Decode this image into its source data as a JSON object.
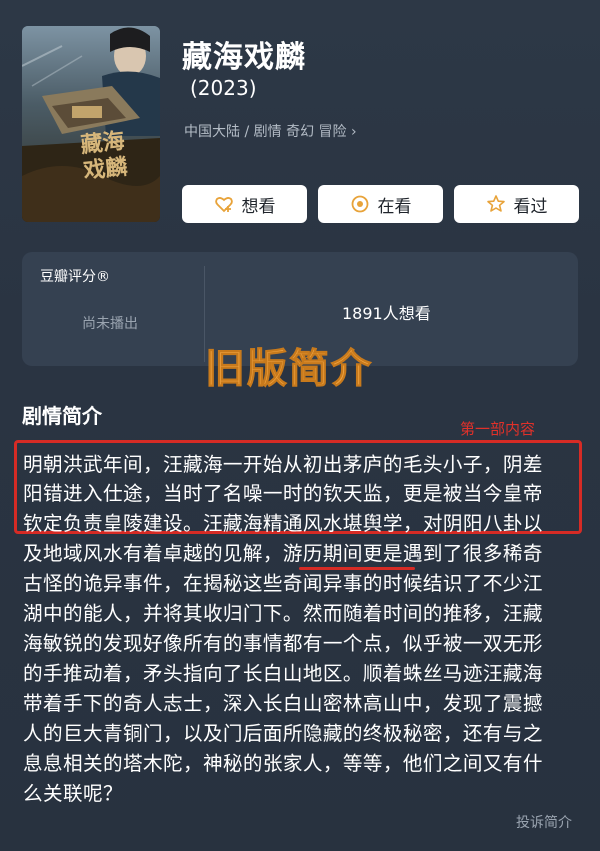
{
  "movie": {
    "title": "藏海戏麟",
    "year": "(2023)",
    "meta": "中国大陆 / 剧情 奇幻 冒险 ›",
    "poster_text": "藏海戏麟"
  },
  "actions": {
    "want": "想看",
    "watching": "在看",
    "watched": "看过"
  },
  "rating": {
    "label": "豆瓣评分®",
    "status": "尚未播出",
    "wish_count": "1891人想看"
  },
  "annotation": {
    "old_version": "旧版简介",
    "part_one": "第一部内容"
  },
  "synopsis": {
    "title": "剧情简介",
    "lines": [
      "明朝洪武年间，汪藏海一开始从初出茅庐的毛头小子，阴差",
      "阳错进入仕途，当时了名噪一时的钦天监，更是被当今皇帝",
      "钦定负责皇陵建设。汪藏海精通风水堪舆学，对阴阳八卦以",
      "及地域风水有着卓越的见解，游历期间更是遇到了很多稀奇",
      "古怪的诡异事件，在揭秘这些奇闻异事的时候结识了不少江",
      "湖中的能人，并将其收归门下。然而随着时间的推移，汪藏",
      "海敏锐的发现好像所有的事情都有一个点，似乎被一双无形",
      "的手推动着，矛头指向了长白山地区。顺着蛛丝马迹汪藏海",
      "带着手下的奇人志士，深入长白山密林高山中，发现了震撼",
      "人的巨大青铜门，以及门后面所隐藏的终极秘密，还有与之",
      "息息相关的塔木陀，神秘的张家人，等等，他们之间又有什",
      "么关联呢？"
    ]
  },
  "footer": {
    "report": "投诉简介"
  },
  "colors": {
    "background": "#2a3442",
    "panel": "#354151",
    "highlight_red": "#d62b25",
    "annotation_orange": "#f0a340"
  },
  "icons": {
    "want": "heart-plus-icon",
    "watching": "target-dot-icon",
    "watched": "star-outline-icon"
  }
}
